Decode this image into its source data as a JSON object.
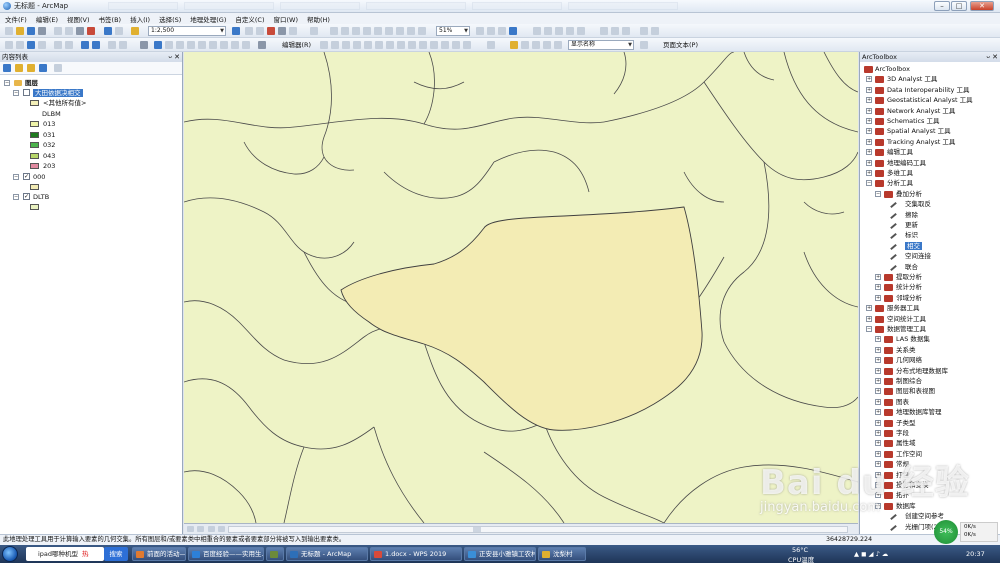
{
  "window": {
    "title": "无标题 - ArcMap",
    "buttons": {
      "minimize": "–",
      "maximize": "□",
      "close": "✕"
    }
  },
  "menu": [
    "文件(F)",
    "编辑(E)",
    "视图(V)",
    "书签(B)",
    "插入(I)",
    "选择(S)",
    "地理处理(G)",
    "自定义(C)",
    "窗口(W)",
    "帮助(H)"
  ],
  "toolbar": {
    "scale": "1:2,500",
    "zoom_percent": "51%",
    "editor_label": "编辑器(R)",
    "display_name": "显示名称",
    "page_text": "页面文本(P)"
  },
  "toc": {
    "title": "内容列表",
    "pin": "ᴗ",
    "close": "✕",
    "root": "图层",
    "layers": [
      {
        "name": "大田依据决相交",
        "expanded": true,
        "checked": false,
        "selected": true,
        "classes": [
          {
            "label": "<其他所有值>",
            "color": "#f3efb8"
          },
          {
            "label": "DLBM",
            "color": ""
          },
          {
            "label": "013",
            "color": "#eef3a8"
          },
          {
            "label": "031",
            "color": "#1f7a1f"
          },
          {
            "label": "032",
            "color": "#4cb24c"
          },
          {
            "label": "043",
            "color": "#b7d66a"
          },
          {
            "label": "203",
            "color": "#e08aa0"
          }
        ]
      },
      {
        "name": "000",
        "expanded": true,
        "checked": true,
        "selected": false,
        "classes": [
          {
            "label": "",
            "color": "#f2ebb4"
          }
        ]
      },
      {
        "name": "DLTB",
        "expanded": true,
        "checked": true,
        "selected": false,
        "classes": [
          {
            "label": "",
            "color": "#e9f1c0"
          }
        ]
      }
    ]
  },
  "toolbox": {
    "title": "ArcToolbox",
    "root": "ArcToolbox",
    "items": [
      {
        "label": "3D Analyst 工具",
        "depth": 0,
        "kind": "box",
        "exp": "+"
      },
      {
        "label": "Data Interoperability 工具",
        "depth": 0,
        "kind": "box",
        "exp": "+"
      },
      {
        "label": "Geostatistical Analyst 工具",
        "depth": 0,
        "kind": "box",
        "exp": "+"
      },
      {
        "label": "Network Analyst 工具",
        "depth": 0,
        "kind": "box",
        "exp": "+"
      },
      {
        "label": "Schematics 工具",
        "depth": 0,
        "kind": "box",
        "exp": "+"
      },
      {
        "label": "Spatial Analyst 工具",
        "depth": 0,
        "kind": "box",
        "exp": "+"
      },
      {
        "label": "Tracking Analyst 工具",
        "depth": 0,
        "kind": "box",
        "exp": "+"
      },
      {
        "label": "编辑工具",
        "depth": 0,
        "kind": "box",
        "exp": "+"
      },
      {
        "label": "地理编码工具",
        "depth": 0,
        "kind": "box",
        "exp": "+"
      },
      {
        "label": "多维工具",
        "depth": 0,
        "kind": "box",
        "exp": "+"
      },
      {
        "label": "分析工具",
        "depth": 0,
        "kind": "box",
        "exp": "−"
      },
      {
        "label": "叠加分析",
        "depth": 1,
        "kind": "set",
        "exp": "−"
      },
      {
        "label": "交集取反",
        "depth": 2,
        "kind": "tool",
        "exp": ""
      },
      {
        "label": "擦除",
        "depth": 2,
        "kind": "tool",
        "exp": ""
      },
      {
        "label": "更新",
        "depth": 2,
        "kind": "tool",
        "exp": ""
      },
      {
        "label": "标识",
        "depth": 2,
        "kind": "tool",
        "exp": ""
      },
      {
        "label": "相交",
        "depth": 2,
        "kind": "tool",
        "exp": "",
        "selected": true
      },
      {
        "label": "空间连接",
        "depth": 2,
        "kind": "tool",
        "exp": ""
      },
      {
        "label": "联合",
        "depth": 2,
        "kind": "tool",
        "exp": ""
      },
      {
        "label": "提取分析",
        "depth": 1,
        "kind": "set",
        "exp": "+"
      },
      {
        "label": "统计分析",
        "depth": 1,
        "kind": "set",
        "exp": "+"
      },
      {
        "label": "邻域分析",
        "depth": 1,
        "kind": "set",
        "exp": "+"
      },
      {
        "label": "服务器工具",
        "depth": 0,
        "kind": "box",
        "exp": "+"
      },
      {
        "label": "空间统计工具",
        "depth": 0,
        "kind": "box",
        "exp": "+"
      },
      {
        "label": "数据管理工具",
        "depth": 0,
        "kind": "box",
        "exp": "−"
      },
      {
        "label": "LAS 数据集",
        "depth": 1,
        "kind": "set",
        "exp": "+"
      },
      {
        "label": "关系类",
        "depth": 1,
        "kind": "set",
        "exp": "+"
      },
      {
        "label": "几何网络",
        "depth": 1,
        "kind": "set",
        "exp": "+"
      },
      {
        "label": "分布式地理数据库",
        "depth": 1,
        "kind": "set",
        "exp": "+"
      },
      {
        "label": "制图综合",
        "depth": 1,
        "kind": "set",
        "exp": "+"
      },
      {
        "label": "图层和表视图",
        "depth": 1,
        "kind": "set",
        "exp": "+"
      },
      {
        "label": "图表",
        "depth": 1,
        "kind": "set",
        "exp": "+"
      },
      {
        "label": "地理数据库管理",
        "depth": 1,
        "kind": "set",
        "exp": "+"
      },
      {
        "label": "子类型",
        "depth": 1,
        "kind": "set",
        "exp": "+"
      },
      {
        "label": "字段",
        "depth": 1,
        "kind": "set",
        "exp": "+"
      },
      {
        "label": "属性域",
        "depth": 1,
        "kind": "set",
        "exp": "+"
      },
      {
        "label": "工作空间",
        "depth": 1,
        "kind": "set",
        "exp": "+"
      },
      {
        "label": "常规",
        "depth": 1,
        "kind": "set",
        "exp": "+"
      },
      {
        "label": "打包",
        "depth": 1,
        "kind": "set",
        "exp": "+"
      },
      {
        "label": "投影和变换",
        "depth": 1,
        "kind": "set",
        "exp": "+"
      },
      {
        "label": "拓扑",
        "depth": 1,
        "kind": "set",
        "exp": "+"
      },
      {
        "label": "数据库",
        "depth": 1,
        "kind": "set",
        "exp": "+"
      },
      {
        "label": "创建空间参考",
        "depth": 2,
        "kind": "tool",
        "exp": ""
      },
      {
        "label": "光栅门项(2)",
        "depth": 2,
        "kind": "tool",
        "exp": ""
      }
    ]
  },
  "status": {
    "message": "此地理处理工具用于计算输入要素的几何交集。所有图层和/或要素类中相重合的要素或者要素部分将被写入到输出要素类。",
    "coords": "36428729.224"
  },
  "taskbar": {
    "search_text": "ipad哪种机型",
    "search_hot": "热",
    "search_button": "搜索",
    "tasks": [
      {
        "label": "前面的活动——宝宝"
      },
      {
        "label": "百度经验——实用生..."
      },
      {
        "label": ""
      },
      {
        "label": "无标题 - ArcMap"
      },
      {
        "label": "1.docx - WPS 2019"
      },
      {
        "label": "正安县小雅镇工农村..."
      },
      {
        "label": "沈梨村"
      }
    ],
    "temp": "56°C",
    "cpu_label": "CPU温度",
    "time": "20:37",
    "cpu_percent": "54%",
    "net_up": "0K/s",
    "net_down": "0K/s"
  },
  "watermark": {
    "brand": "Bai du 经验",
    "url": "jingyan.baidu.com"
  }
}
